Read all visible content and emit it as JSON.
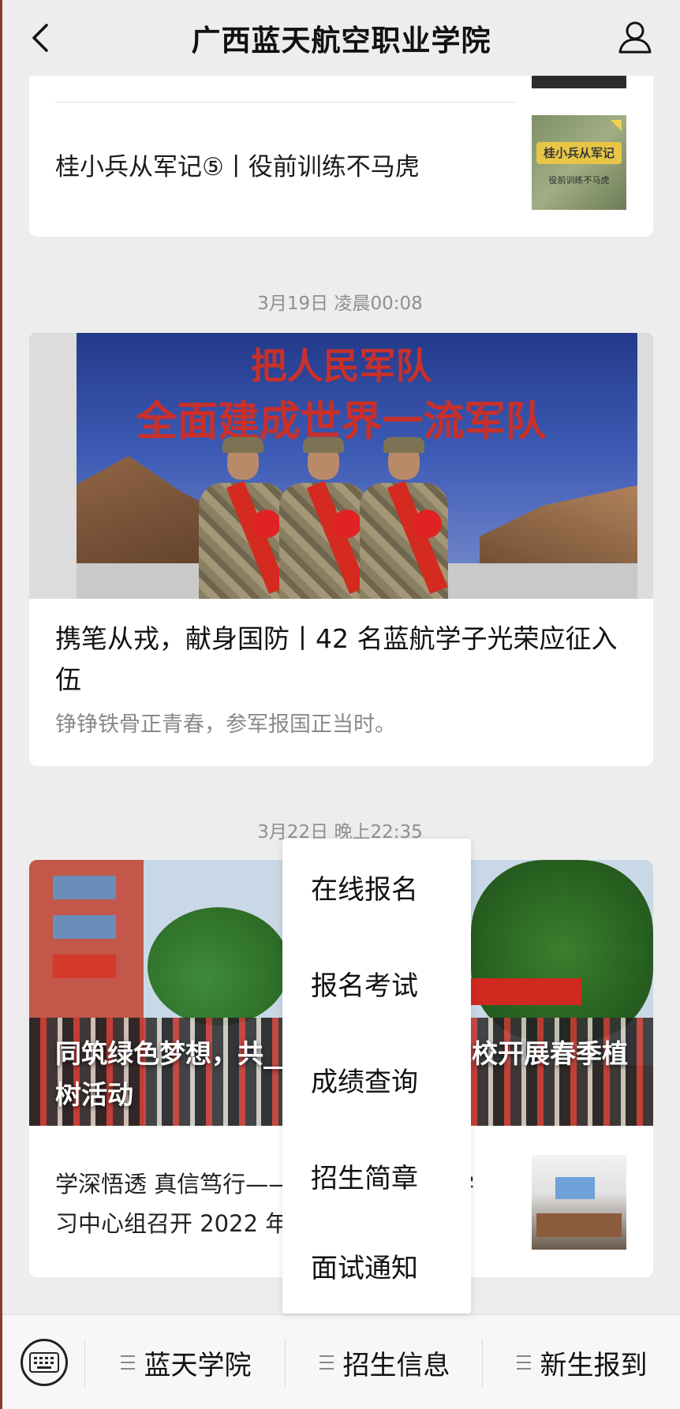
{
  "header": {
    "title": "广西蓝天航空职业学院"
  },
  "feed": {
    "card1": {
      "item_title": "桂小兵从军记⑤丨役前训练不马虎",
      "thumb_banner": "桂小兵从军记",
      "thumb_sub": "役前训练不马虎"
    },
    "timestamp1": "3月19日 凌晨00:08",
    "card2": {
      "hero_line1": "把人民军队",
      "hero_line2": "全面建成世界一流军队",
      "headline": "携笔从戎，献身国防丨42 名蓝航学子光荣应征入伍",
      "description": "铮铮铁骨正青春，参军报国正当时。"
    },
    "timestamp2": "3月22日 晚上22:35",
    "card3": {
      "hero_headline": "同筑绿色梦想，共______________我校开展春季植树活动",
      "row_text": "学深悟透 真信笃行——______________学习中心组召开 2022 年______________"
    }
  },
  "popup_menu": {
    "items": [
      "在线报名",
      "报名考试",
      "成绩查询",
      "招生简章",
      "面试通知"
    ]
  },
  "bottom_bar": {
    "tabs": [
      "蓝天学院",
      "招生信息",
      "新生报到"
    ]
  },
  "icons": {
    "back": "chevron-left-icon",
    "profile": "person-icon",
    "keyboard": "keyboard-icon",
    "menu": "hamburger-icon"
  },
  "colors": {
    "background": "#ededed",
    "card": "#ffffff",
    "timestamp": "#8f8f8f",
    "secondary_text": "#8a8a8a"
  }
}
